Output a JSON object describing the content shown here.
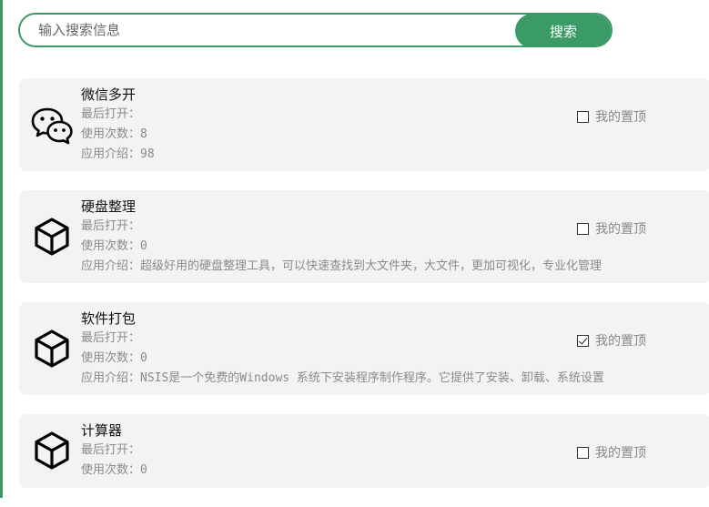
{
  "search": {
    "placeholder": "输入搜索信息",
    "value": "",
    "button_label": "搜索"
  },
  "colors": {
    "accent": "#3a9b66",
    "card_background": "#f3f3f3",
    "muted_text": "#8a8a8a"
  },
  "apps": [
    {
      "name": "微信多开",
      "icon": "wechat-icon",
      "last_opened": "最后打开：",
      "usage": "使用次数：8",
      "intro": "应用介绍：98",
      "pin_label": "我的置顶",
      "pinned": false
    },
    {
      "name": "硬盘整理",
      "icon": "cube-icon",
      "last_opened": "最后打开：",
      "usage": "使用次数：0",
      "intro": "应用介绍：超级好用的硬盘整理工具，可以快速查找到大文件夹，大文件，更加可视化，专业化管理",
      "pin_label": "我的置顶",
      "pinned": false
    },
    {
      "name": "软件打包",
      "icon": "cube-icon",
      "last_opened": "最后打开：",
      "usage": "使用次数：0",
      "intro": "应用介绍：NSIS是一个免费的Windows 系统下安装程序制作程序。它提供了安装、卸载、系统设置",
      "pin_label": "我的置顶",
      "pinned": true
    },
    {
      "name": "计算器",
      "icon": "cube-icon",
      "last_opened": "最后打开：",
      "usage": "使用次数：0",
      "intro": "",
      "pin_label": "我的置顶",
      "pinned": false
    }
  ]
}
